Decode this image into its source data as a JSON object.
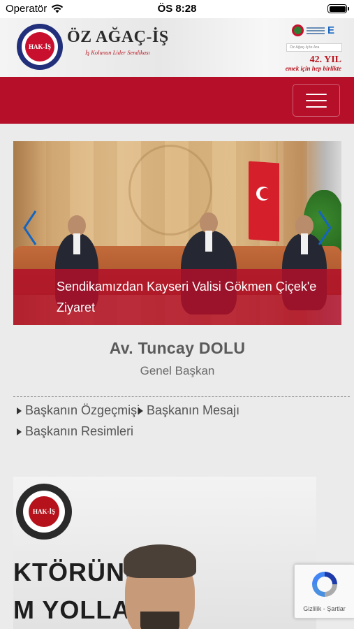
{
  "status_bar": {
    "carrier": "Operatör",
    "time": "ÖS 8:28"
  },
  "header": {
    "brand_name": "ÖZ AĞAÇ-İŞ",
    "brand_tagline": "İş Kolunun Lider Sendikası",
    "seal_text": "HAK-İŞ",
    "search_placeholder": "Öz Ağaç-İş'te Ara",
    "year_badge": "42. YIL",
    "year_slogan": "emek için hep birlikte"
  },
  "nav": {
    "menu_icon": "hamburger-menu-icon"
  },
  "slider": {
    "caption": "Sendikamızdan Kayseri Valisi Gökmen Çiçek'e Ziyaret",
    "prev_icon": "chevron-left-icon",
    "next_icon": "chevron-right-icon"
  },
  "president": {
    "name": "Av. Tuncay DOLU",
    "title": "Genel Başkan",
    "links": [
      {
        "label": "Başkanın Özgeçmişi"
      },
      {
        "label": "Başkanın Mesajı"
      },
      {
        "label": "Başkanın Resimleri"
      }
    ]
  },
  "bottom_photo": {
    "seal_text": "HAK-İŞ",
    "line1": "KTÖRÜNÜN",
    "line2": "M YOLLARI"
  },
  "recaptcha": {
    "footer": "Gizlilik - Şartlar"
  },
  "colors": {
    "brand_red": "#b50f2a",
    "caption_red": "#b21028",
    "seal_blue": "#22307c",
    "slider_arrow_blue": "#1565c0"
  }
}
